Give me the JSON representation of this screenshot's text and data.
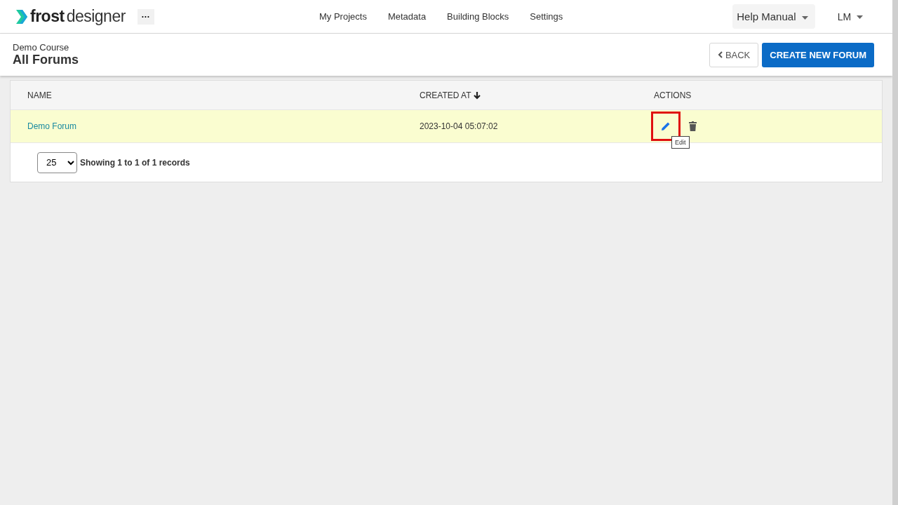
{
  "header": {
    "logo": {
      "bold": "frost",
      "light": "designer"
    },
    "more_button": "···",
    "nav": [
      "My Projects",
      "Metadata",
      "Building Blocks",
      "Settings"
    ],
    "help_menu": "Help Manual",
    "user_menu": "LM"
  },
  "page_header": {
    "breadcrumb": "Demo Course",
    "title": "All Forums",
    "back_button": "BACK",
    "create_button": "CREATE NEW FORUM"
  },
  "table": {
    "columns": [
      {
        "label": "NAME",
        "sorted": false
      },
      {
        "label": "CREATED AT",
        "sorted": true
      },
      {
        "label": "ACTIONS",
        "sorted": false
      }
    ],
    "rows": [
      {
        "name": "Demo Forum",
        "created_at": "2023-10-04 05:07:02",
        "selected": true,
        "edit_highlighted": true,
        "tooltip": "Edit"
      }
    ],
    "page_size": "25",
    "summary": "Showing 1 to 1 of 1 records"
  }
}
